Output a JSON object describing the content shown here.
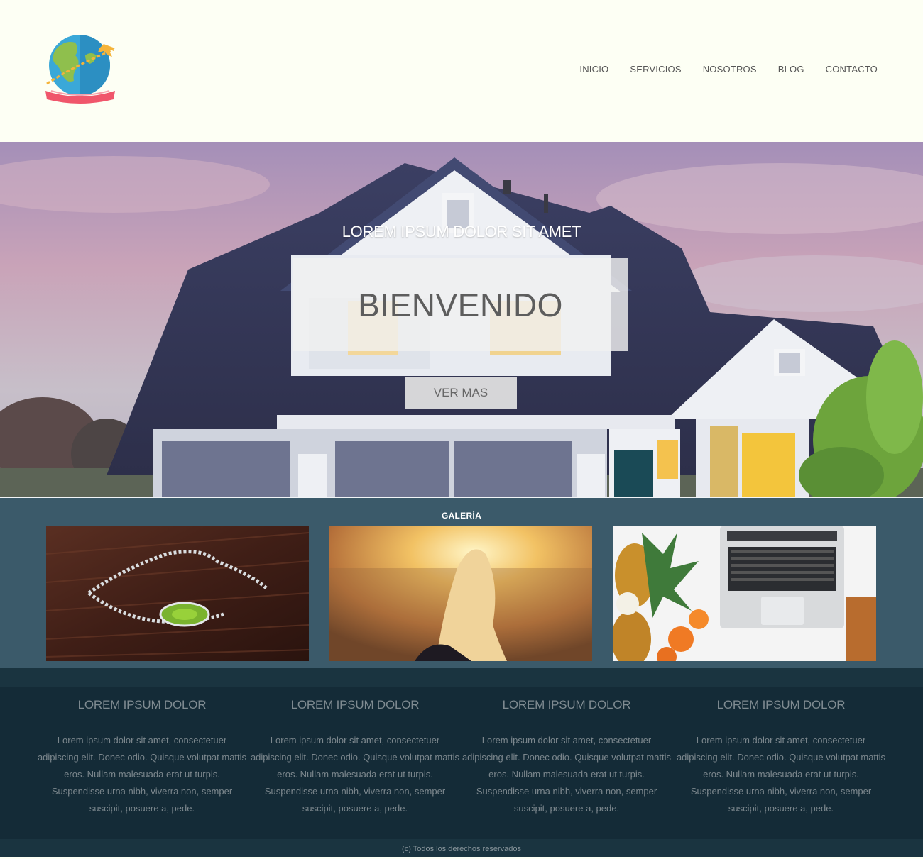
{
  "nav": {
    "items": [
      "INICIO",
      "SERVICIOS",
      "NOSOTROS",
      "BLOG",
      "CONTACTO"
    ]
  },
  "hero": {
    "subtitle": "LOREM IPSUM DOLOR SIT AMET",
    "title": "BIENVENIDO",
    "button_label": "VER MAS"
  },
  "gallery": {
    "title": "GALERÍA",
    "images": [
      "necklace-photo",
      "girl-sunset-photo",
      "laptop-fruits-photo"
    ]
  },
  "features": [
    {
      "title": "LOREM IPSUM DOLOR",
      "text": "Lorem ipsum dolor sit amet, consectetuer adipiscing elit. Donec odio. Quisque volutpat mattis eros. Nullam malesuada erat ut turpis. Suspendisse urna nibh, viverra non, semper suscipit, posuere a, pede."
    },
    {
      "title": "LOREM IPSUM DOLOR",
      "text": "Lorem ipsum dolor sit amet, consectetuer adipiscing elit. Donec odio. Quisque volutpat mattis eros. Nullam malesuada erat ut turpis. Suspendisse urna nibh, viverra non, semper suscipit, posuere a, pede."
    },
    {
      "title": "LOREM IPSUM DOLOR",
      "text": "Lorem ipsum dolor sit amet, consectetuer adipiscing elit. Donec odio. Quisque volutpat mattis eros. Nullam malesuada erat ut turpis. Suspendisse urna nibh, viverra non, semper suscipit, posuere a, pede."
    },
    {
      "title": "LOREM IPSUM DOLOR",
      "text": "Lorem ipsum dolor sit amet, consectetuer adipiscing elit. Donec odio. Quisque volutpat mattis eros. Nullam malesuada erat ut turpis. Suspendisse urna nibh, viverra non, semper suscipit, posuere a, pede."
    }
  ],
  "footer": {
    "text": "(c) Todos los derechos reservados"
  },
  "colors": {
    "header_bg": "#fdfff4",
    "gallery_bg": "#3b5a6a",
    "features_bg": "#142b37",
    "footer_bg": "#1a3440"
  }
}
